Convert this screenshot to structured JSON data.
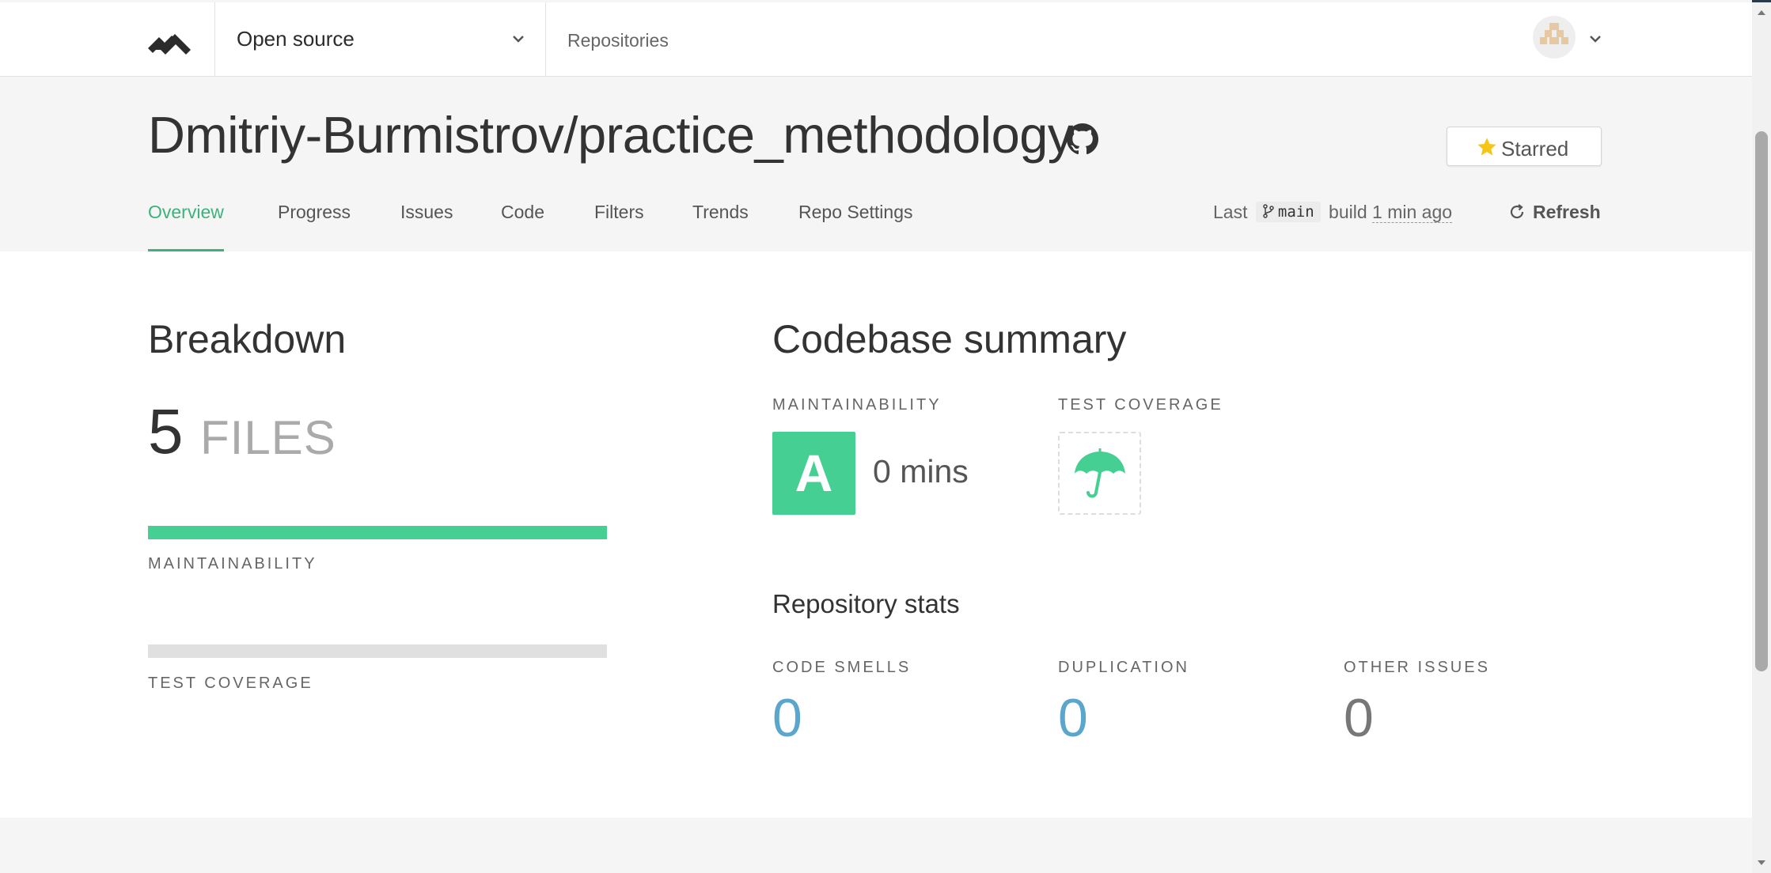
{
  "header": {
    "org_name": "Open source",
    "repositories_link": "Repositories"
  },
  "repo": {
    "title": "Dmitriy-Burmistrov/practice_methodology",
    "starred_label": "Starred",
    "star_color": "#f5c518"
  },
  "tabs": [
    {
      "label": "Overview",
      "active": true
    },
    {
      "label": "Progress"
    },
    {
      "label": "Issues"
    },
    {
      "label": "Code"
    },
    {
      "label": "Filters"
    },
    {
      "label": "Trends"
    },
    {
      "label": "Repo Settings"
    }
  ],
  "build": {
    "prefix": "Last",
    "branch": "main",
    "middle": "build",
    "time": "1 min ago",
    "refresh_label": "Refresh"
  },
  "breakdown": {
    "title": "Breakdown",
    "files_count": "5",
    "files_label": "FILES",
    "maintainability_label": "MAINTAINABILITY",
    "maintainability_fill": 1.0,
    "coverage_label": "TEST COVERAGE",
    "coverage_fill": 0
  },
  "summary": {
    "title": "Codebase summary",
    "maintainability_label": "MAINTAINABILITY",
    "grade": "A",
    "tech_debt": "0 mins",
    "coverage_label": "TEST COVERAGE",
    "coverage_icon": "umbrella-icon"
  },
  "stats": {
    "title": "Repository stats",
    "items": [
      {
        "label": "CODE SMELLS",
        "value": "0"
      },
      {
        "label": "DUPLICATION",
        "value": "0"
      },
      {
        "label": "OTHER ISSUES",
        "value": "0"
      }
    ]
  },
  "colors": {
    "accent_green": "#3ab37c",
    "grade_green": "#45cf92",
    "stat_blue": "#5aa6cd"
  }
}
